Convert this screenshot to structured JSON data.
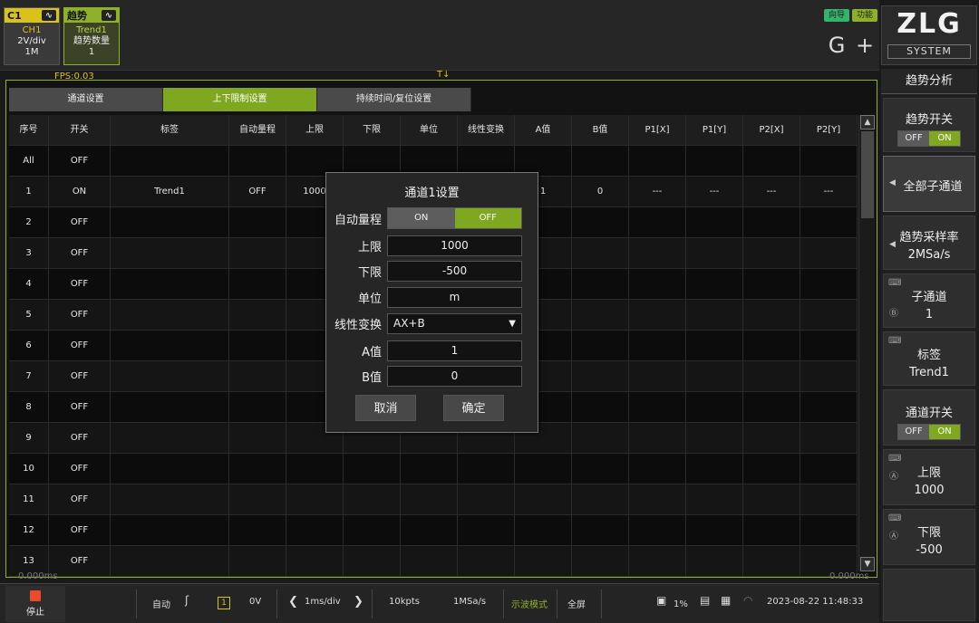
{
  "top": {
    "c1_tile": {
      "tag": "C1",
      "name": "CH1",
      "scale": "2V/div",
      "depth": "1M"
    },
    "trend_tile": {
      "tag": "趋势",
      "name": "Trend1",
      "label": "趋势数量",
      "count": "1"
    },
    "guide_label": "向导",
    "function_label": "功能",
    "fps": "FPS:0.03",
    "trigger_mark": "T↓"
  },
  "logo": {
    "brand": "ZLG",
    "system": "SYSTEM"
  },
  "tabs": [
    {
      "label": "通道设置"
    },
    {
      "label": "上下限制设置"
    },
    {
      "label": "持续时间/复位设置"
    }
  ],
  "table": {
    "headers": [
      "序号",
      "开关",
      "标签",
      "自动量程",
      "上限",
      "下限",
      "单位",
      "线性变换",
      "A值",
      "B值",
      "P1[X]",
      "P1[Y]",
      "P2[X]",
      "P2[Y]"
    ],
    "rows": [
      [
        "All",
        "OFF",
        "",
        "",
        "",
        "",
        "",
        "",
        "",
        "",
        "",
        "",
        "",
        ""
      ],
      [
        "1",
        "ON",
        "Trend1",
        "OFF",
        "1000",
        "",
        "",
        "",
        "1",
        "0",
        "---",
        "---",
        "---",
        "---"
      ],
      [
        "2",
        "OFF",
        "",
        "",
        "",
        "",
        "",
        "",
        "",
        "",
        "",
        "",
        "",
        ""
      ],
      [
        "3",
        "OFF",
        "",
        "",
        "",
        "",
        "",
        "",
        "",
        "",
        "",
        "",
        "",
        ""
      ],
      [
        "4",
        "OFF",
        "",
        "",
        "",
        "",
        "",
        "",
        "",
        "",
        "",
        "",
        "",
        ""
      ],
      [
        "5",
        "OFF",
        "",
        "",
        "",
        "",
        "",
        "",
        "",
        "",
        "",
        "",
        "",
        ""
      ],
      [
        "6",
        "OFF",
        "",
        "",
        "",
        "",
        "",
        "",
        "",
        "",
        "",
        "",
        "",
        ""
      ],
      [
        "7",
        "OFF",
        "",
        "",
        "",
        "",
        "",
        "",
        "",
        "",
        "",
        "",
        "",
        ""
      ],
      [
        "8",
        "OFF",
        "",
        "",
        "",
        "",
        "",
        "",
        "",
        "",
        "",
        "",
        "",
        ""
      ],
      [
        "9",
        "OFF",
        "",
        "",
        "",
        "",
        "",
        "",
        "",
        "",
        "",
        "",
        "",
        ""
      ],
      [
        "10",
        "OFF",
        "",
        "",
        "",
        "",
        "",
        "",
        "",
        "",
        "",
        "",
        "",
        ""
      ],
      [
        "11",
        "OFF",
        "",
        "",
        "",
        "",
        "",
        "",
        "",
        "",
        "",
        "",
        "",
        ""
      ],
      [
        "12",
        "OFF",
        "",
        "",
        "",
        "",
        "",
        "",
        "",
        "",
        "",
        "",
        "",
        ""
      ],
      [
        "13",
        "OFF",
        "",
        "",
        "",
        "",
        "",
        "",
        "",
        "",
        "",
        "",
        "",
        ""
      ]
    ]
  },
  "dialog": {
    "title": "通道1设置",
    "auto_range_label": "自动量程",
    "toggle_on": "ON",
    "toggle_off": "OFF",
    "upper_label": "上限",
    "upper_value": "1000",
    "lower_label": "下限",
    "lower_value": "-500",
    "unit_label": "单位",
    "unit_value": "m",
    "linear_label": "线性变换",
    "linear_value": "AX+B",
    "a_label": "A值",
    "a_value": "1",
    "b_label": "B值",
    "b_value": "0",
    "cancel": "取消",
    "ok": "确定"
  },
  "right": {
    "title": "趋势分析",
    "trend_switch": {
      "label": "趋势开关",
      "off": "OFF",
      "on": "ON"
    },
    "all_sub": "全部子通道",
    "sample_rate": {
      "label": "趋势采样率",
      "value": "2MSa/s"
    },
    "sub_channel": {
      "label": "子通道",
      "value": "1",
      "knob": "Ⓑ"
    },
    "tag": {
      "label": "标签",
      "value": "Trend1"
    },
    "channel_switch": {
      "label": "通道开关",
      "off": "OFF",
      "on": "ON"
    },
    "upper": {
      "label": "上限",
      "value": "1000",
      "knob": "Ⓐ"
    },
    "lower": {
      "label": "下限",
      "value": "-500",
      "knob": "Ⓐ"
    }
  },
  "scale": {
    "left": "0.000ms",
    "right": "0.000ms"
  },
  "bottom": {
    "stop": "停止",
    "mode": "自动",
    "trig_ch": "1",
    "trig_level": "0V",
    "timebase": "1ms/div",
    "points": "10kpts",
    "sample_rate": "1MSa/s",
    "display_mode": "示波模式",
    "fullscreen": "全屏",
    "percent": "1%",
    "datetime": "2023-08-22 11:48:33"
  },
  "colors": {
    "accent": "#7fa820",
    "ch1_yellow": "#d9c21a",
    "stop_red": "#e84c2b"
  }
}
